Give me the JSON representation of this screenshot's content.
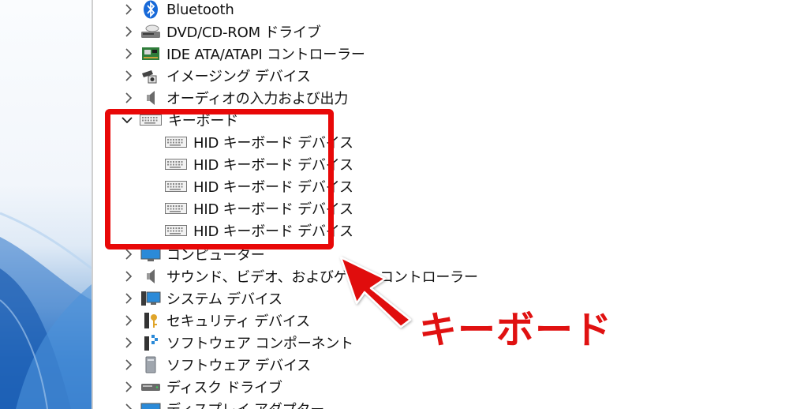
{
  "device_tree": {
    "items": [
      {
        "label": "Bluetooth",
        "icon": "bluetooth-icon",
        "expanded": false
      },
      {
        "label": "DVD/CD-ROM ドライブ",
        "icon": "dvd-drive-icon",
        "expanded": false
      },
      {
        "label": "IDE ATA/ATAPI コントローラー",
        "icon": "ide-controller-icon",
        "expanded": false
      },
      {
        "label": "イメージング デバイス",
        "icon": "camera-icon",
        "expanded": false
      },
      {
        "label": "オーディオの入力および出力",
        "icon": "speaker-icon",
        "expanded": false
      },
      {
        "label": "キーボード",
        "icon": "keyboard-icon",
        "expanded": true
      },
      {
        "label": "コンピューター",
        "icon": "monitor-icon",
        "expanded": false
      },
      {
        "label": "サウンド、ビデオ、およびゲーム コントローラー",
        "icon": "speaker-icon",
        "expanded": false
      },
      {
        "label": "システム デバイス",
        "icon": "system-device-icon",
        "expanded": false
      },
      {
        "label": "セキュリティ デバイス",
        "icon": "security-key-icon",
        "expanded": false
      },
      {
        "label": "ソフトウェア コンポーネント",
        "icon": "software-component-icon",
        "expanded": false
      },
      {
        "label": "ソフトウェア デバイス",
        "icon": "software-device-icon",
        "expanded": false
      },
      {
        "label": "ディスク ドライブ",
        "icon": "disk-drive-icon",
        "expanded": false
      },
      {
        "label": "ディスプレイ アダプター",
        "icon": "display-adapter-icon",
        "expanded": false
      }
    ],
    "keyboard_children": [
      {
        "label": "HID キーボード デバイス",
        "icon": "keyboard-icon"
      },
      {
        "label": "HID キーボード デバイス",
        "icon": "keyboard-icon"
      },
      {
        "label": "HID キーボード デバイス",
        "icon": "keyboard-icon"
      },
      {
        "label": "HID キーボード デバイス",
        "icon": "keyboard-icon"
      },
      {
        "label": "HID キーボード デバイス",
        "icon": "keyboard-icon"
      }
    ]
  },
  "annotation": {
    "callout_text": "キーボード",
    "highlight_color": "#e80808",
    "callout_color": "#e01111"
  }
}
